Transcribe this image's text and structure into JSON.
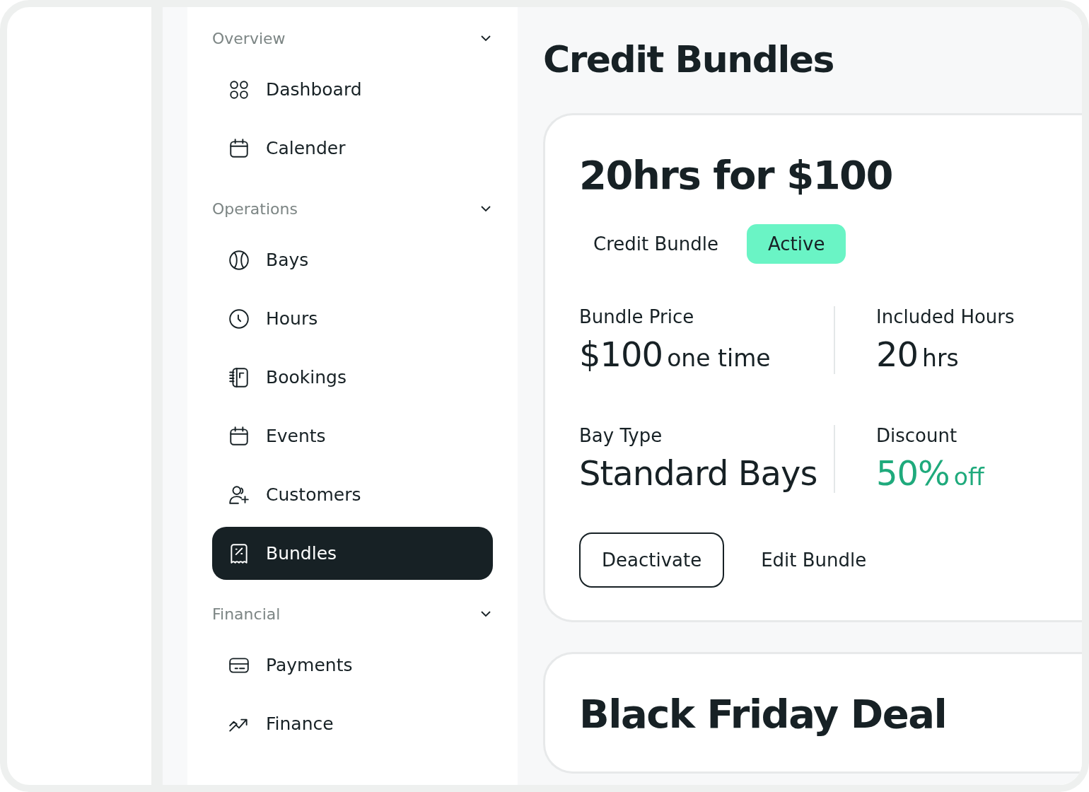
{
  "sidebar": {
    "sections": [
      {
        "title": "Overview",
        "expanded": true,
        "items": [
          {
            "label": "Dashboard",
            "selected": false
          },
          {
            "label": "Calender",
            "selected": false
          }
        ]
      },
      {
        "title": "Operations",
        "expanded": true,
        "items": [
          {
            "label": "Bays",
            "selected": false
          },
          {
            "label": "Hours",
            "selected": false
          },
          {
            "label": "Bookings",
            "selected": false
          },
          {
            "label": "Events",
            "selected": false
          },
          {
            "label": "Customers",
            "selected": false
          },
          {
            "label": "Bundles",
            "selected": true
          }
        ]
      },
      {
        "title": "Financial",
        "expanded": true,
        "items": [
          {
            "label": "Payments",
            "selected": false
          },
          {
            "label": "Finance",
            "selected": false
          }
        ]
      }
    ]
  },
  "page": {
    "title": "Credit Bundles"
  },
  "bundles": [
    {
      "title": "20hrs for $100",
      "type": "Credit Bundle",
      "status": "Active",
      "stats": [
        {
          "label": "Bundle Price",
          "value": "$100",
          "unit": "one time",
          "kind": "plain"
        },
        {
          "label": "Included Hours",
          "value": "20",
          "unit": "hrs",
          "kind": "plain"
        },
        {
          "label": "Bay Type",
          "value": "Standard Bays",
          "kind": "plain"
        },
        {
          "label": "Discount",
          "value": "50%",
          "unit": "off",
          "kind": "highlight"
        }
      ],
      "actions": [
        {
          "label": "Deactivate",
          "kind": "outlined"
        },
        {
          "label": "Edit Bundle",
          "kind": "text"
        }
      ]
    },
    {
      "title": "Black Friday Deal"
    }
  ]
}
